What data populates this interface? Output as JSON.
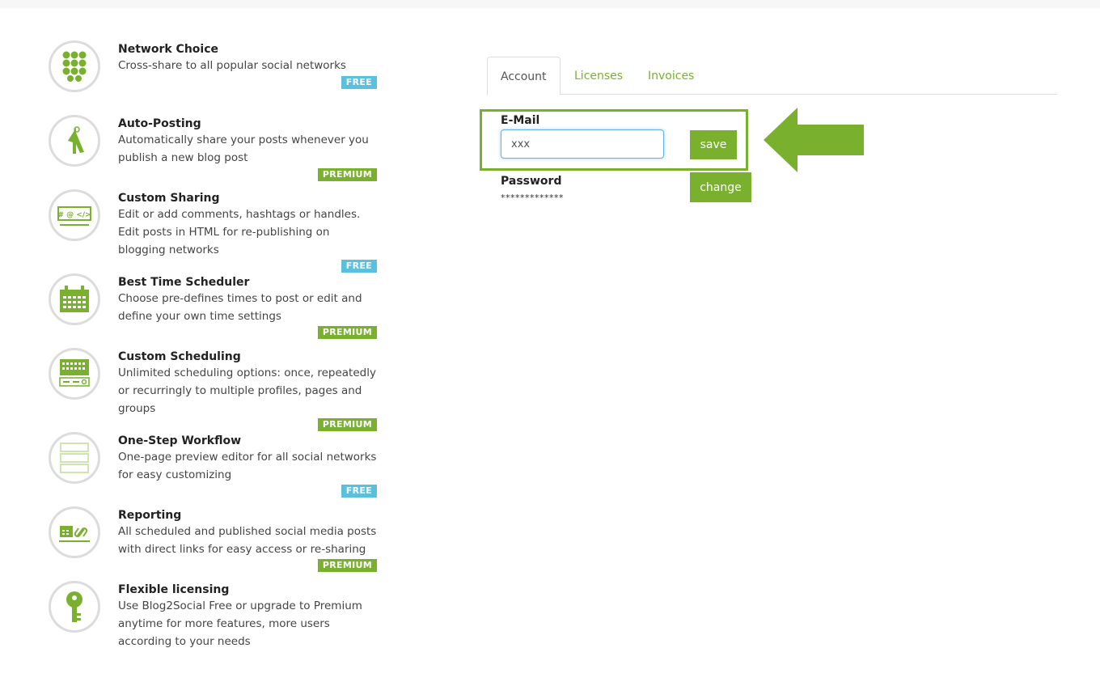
{
  "features": [
    {
      "title": "Network Choice",
      "desc": "Cross-share to all popular social networks",
      "badge": "FREE"
    },
    {
      "title": "Auto-Posting",
      "desc": "Automatically share your posts whenever you publish a new blog post",
      "badge": "PREMIUM"
    },
    {
      "title": "Custom Sharing",
      "desc": "Edit or add comments, hashtags or handles. Edit posts in HTML for re-publishing on blogging networks",
      "badge": "FREE"
    },
    {
      "title": "Best Time Scheduler",
      "desc": "Choose pre-defines times to post or edit and define your own time settings",
      "badge": "PREMIUM"
    },
    {
      "title": "Custom Scheduling",
      "desc": "Unlimited scheduling options: once, repeatedly or recurringly to multiple profiles, pages and groups",
      "badge": "PREMIUM"
    },
    {
      "title": "One-Step Workflow",
      "desc": "One-page preview editor for all social networks for easy customizing",
      "badge": "FREE"
    },
    {
      "title": "Reporting",
      "desc": "All scheduled and published social media posts with direct links for easy access or re-sharing",
      "badge": "PREMIUM"
    },
    {
      "title": "Flexible licensing",
      "desc": "Use Blog2Social Free or upgrade to Premium anytime for more features, more users according to your needs"
    }
  ],
  "tabs": [
    "Account",
    "Licenses",
    "Invoices"
  ],
  "account": {
    "email_label": "E-Mail",
    "email_value": "xxx",
    "save_label": "save",
    "password_label": "Password",
    "password_value": "*************",
    "change_label": "change"
  },
  "colors": {
    "accent": "#79b12e",
    "free_badge": "#5bc0de",
    "premium_badge": "#79b12e"
  },
  "icons": [
    "network-icon",
    "cursor-icon",
    "code-tags-icon",
    "calendar-icon",
    "calendar-grid-icon",
    "workflow-icon",
    "report-link-icon",
    "key-icon",
    "arrow-left-icon"
  ]
}
